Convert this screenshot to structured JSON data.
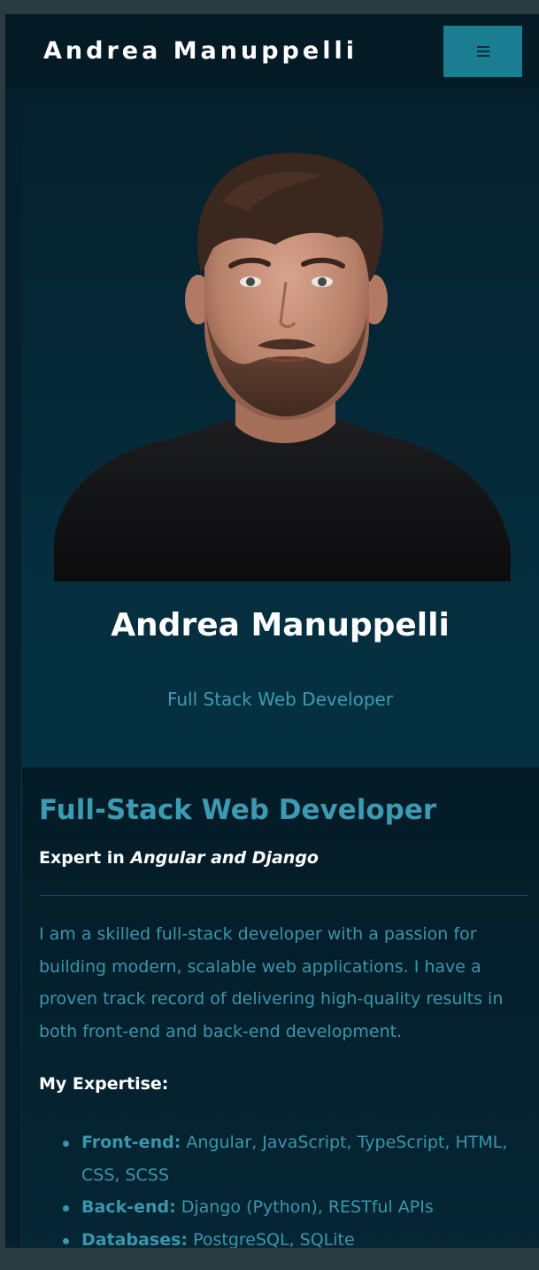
{
  "navbar": {
    "brand": "Andrea Manuppelli",
    "menu_icon": "hamburger-icon"
  },
  "hero": {
    "photo": "portrait-photo",
    "name": "Andrea Manuppelli",
    "role": "Full Stack Web Developer"
  },
  "about": {
    "title": "Full-Stack Web Developer",
    "subtitle_prefix": "Expert in",
    "subtitle_emphasis": "Angular and Django",
    "paragraph": "I am a skilled full-stack developer with a passion for building modern, scalable web applications. I have a proven track record of delivering high-quality results in both front-end and back-end development.",
    "expertise_heading": "My Expertise:",
    "expertise": [
      {
        "label": "Front-end:",
        "text": "Angular, JavaScript, TypeScript, HTML, CSS, SCSS"
      },
      {
        "label": "Back-end:",
        "text": "Django (Python), RESTful APIs"
      },
      {
        "label": "Databases:",
        "text": "PostgreSQL, SQLite"
      }
    ]
  },
  "colors": {
    "page_bg": "#05202c",
    "accent": "#1a7d91",
    "text_accent": "#3b96ab",
    "heading": "#ffffff"
  }
}
